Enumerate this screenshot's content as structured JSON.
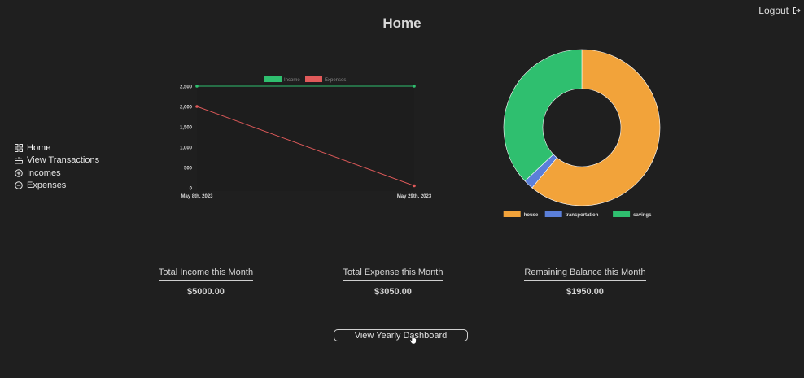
{
  "header": {
    "title": "Home",
    "logout_label": "Logout"
  },
  "sidebar": {
    "items": [
      {
        "label": "Home",
        "icon": "grid-icon",
        "active": true
      },
      {
        "label": "View Transactions",
        "icon": "transactions-icon",
        "active": false
      },
      {
        "label": "Incomes",
        "icon": "plus-circle-icon",
        "active": false
      },
      {
        "label": "Expenses",
        "icon": "minus-circle-icon",
        "active": false
      }
    ]
  },
  "summary": {
    "income_label": "Total Income this Month",
    "income_value": "$5000.00",
    "expense_label": "Total Expense this Month",
    "expense_value": "$3050.00",
    "balance_label": "Remaining Balance this Month",
    "balance_value": "$1950.00"
  },
  "yearly_button_label": "View Yearly Dashboard",
  "colors": {
    "background": "#1f1f1f",
    "income": "#2fbf6f",
    "expenses": "#e05a5a",
    "house": "#f2a33a",
    "transportation": "#5b7fd9",
    "savings": "#2fbf6f"
  },
  "chart_data": [
    {
      "type": "line",
      "x": [
        "May 8th, 2023",
        "May 29th, 2023"
      ],
      "series": [
        {
          "name": "Income",
          "values": [
            2500,
            2500
          ],
          "color": "#2fbf6f"
        },
        {
          "name": "Expenses",
          "values": [
            2000,
            50
          ],
          "color": "#e05a5a"
        }
      ],
      "yticks": [
        0,
        500,
        1000,
        1500,
        2000,
        2500
      ],
      "ytick_labels": [
        "0",
        "500",
        "1,000",
        "1,500",
        "2,000",
        "2,500"
      ],
      "ylim": [
        0,
        2500
      ],
      "legend": "top",
      "grid": false
    },
    {
      "type": "pie",
      "categories": [
        "house",
        "transportation",
        "savings"
      ],
      "values": [
        3050,
        100,
        1850
      ],
      "colors": [
        "#f2a33a",
        "#5b7fd9",
        "#2fbf6f"
      ],
      "legend": "bottom"
    }
  ]
}
